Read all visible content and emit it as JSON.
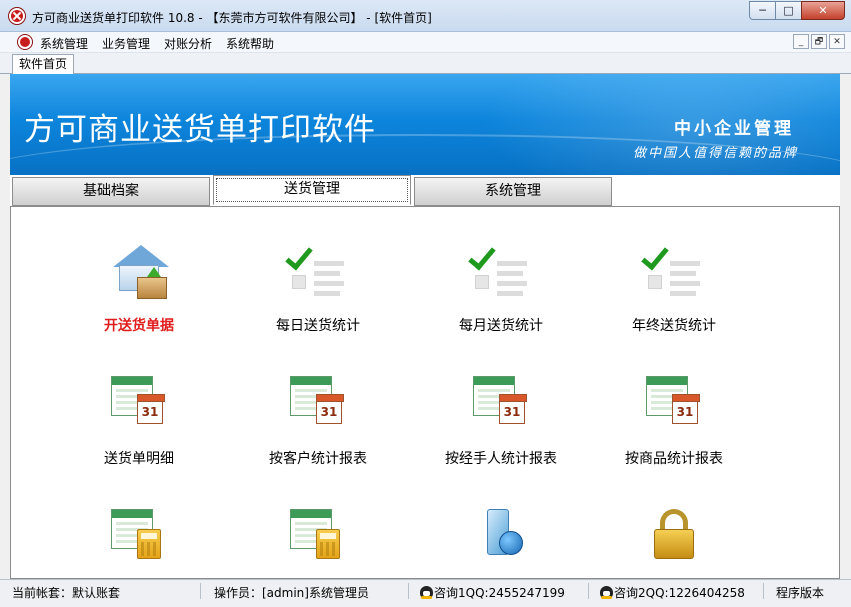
{
  "window": {
    "title": "方可商业送货单打印软件 10.8 - 【东莞市方可软件有限公司】 - [软件首页]",
    "minimize": "─",
    "maximize": "□",
    "close": "✕"
  },
  "menu": {
    "items": [
      "系统管理",
      "业务管理",
      "对账分析",
      "系统帮助"
    ],
    "mdi_buttons": [
      "_",
      "🗗",
      "✕"
    ]
  },
  "doc_tab": "软件首页",
  "banner": {
    "title": "方可商业送货单打印软件",
    "slogan_line1": "中小企业管理",
    "slogan_line2": "做中国人值得信赖的品牌"
  },
  "main_tabs": [
    {
      "label": "基础档案",
      "active": false
    },
    {
      "label": "送货管理",
      "active": true
    },
    {
      "label": "系统管理",
      "active": false
    }
  ],
  "grid": {
    "row1": [
      "开送货单据",
      "每日送货统计",
      "每月送货统计",
      "年终送货统计"
    ],
    "row2": [
      "送货单明细",
      "按客户统计报表",
      "按经手人统计报表",
      "按商品统计报表"
    ],
    "calendar_day": "31"
  },
  "status": {
    "account": "当前帐套：默认账套",
    "operator": "操作员：[admin]系统管理员",
    "qq1": "咨询1QQ:2455247199",
    "qq2": "咨询2QQ:1226404258",
    "version": "程序版本"
  },
  "colors": {
    "banner": "#0d85dc",
    "highlight_label": "#e11c1c",
    "check": "#1f9a1f"
  }
}
